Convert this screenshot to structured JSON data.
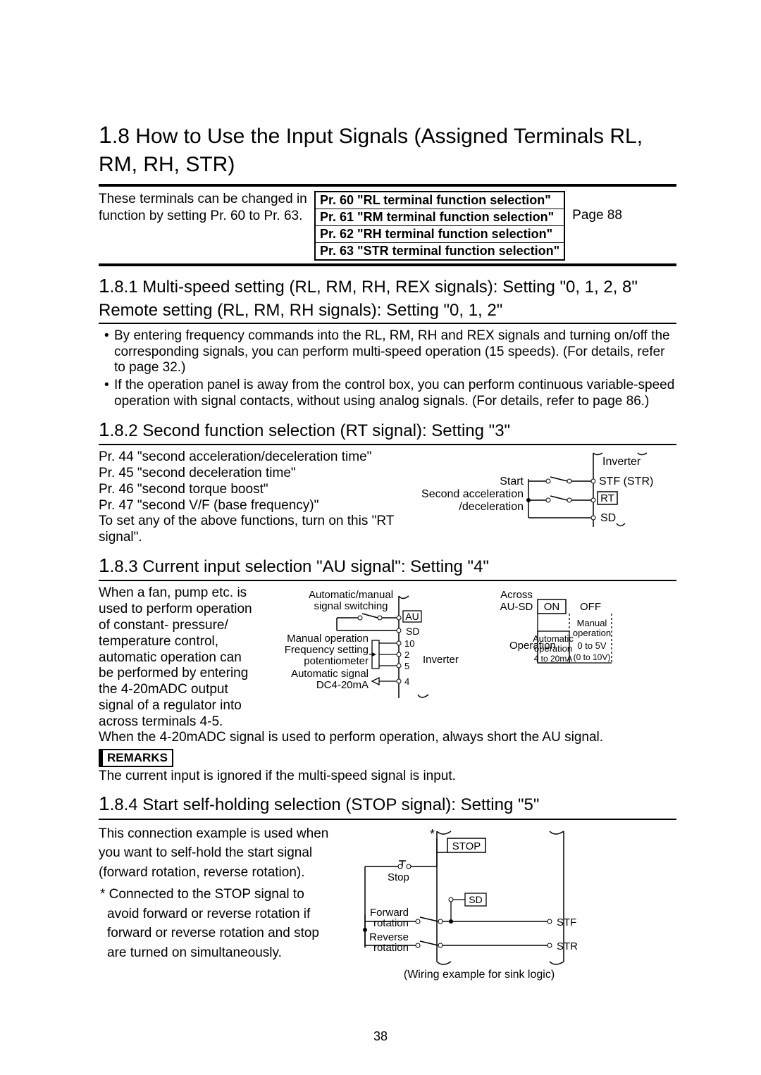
{
  "page_number": "38",
  "title_prefix": "1",
  "title_rest": ".8 How to Use the Input Signals (Assigned Terminals RL, RM, RH, STR)",
  "intro_text": "These terminals can be changed in function by setting Pr. 60 to Pr. 63.",
  "param_list": [
    "Pr. 60 \"RL terminal function selection\"",
    "Pr. 61 \"RM terminal function selection\"",
    "Pr. 62 \"RH terminal function selection\"",
    "Pr. 63 \"STR terminal function selection\""
  ],
  "page_ref": "Page 88",
  "s181": {
    "num": "1",
    "rest": ".8.1 Multi-speed setting (RL, RM, RH, REX signals): Setting \"0, 1, 2, 8\" Remote setting (RL, RM, RH signals): Setting \"0, 1, 2\"",
    "bullets": [
      "By entering frequency commands into the RL, RM, RH and REX signals and turning on/off the corresponding signals, you can perform multi-speed operation (15 speeds). (For details, refer to page 32.)",
      "If the operation panel is away from the control box, you can perform continuous variable-speed operation with signal contacts, without using analog signals. (For details, refer to page 86.)"
    ]
  },
  "s182": {
    "num": "1",
    "rest": ".8.2 Second function selection (RT signal): Setting \"3\"",
    "lines": [
      "Pr. 44 \"second acceleration/deceleration time\"",
      "Pr. 45 \"second deceleration time\"",
      "Pr. 46 \"second torque boost\"",
      "Pr. 47 \"second V/F (base frequency)\"",
      "To set any of the above functions, turn on this \"RT signal\"."
    ],
    "diagram": {
      "inverter": "Inverter",
      "start": "Start",
      "sec_accel1": "Second acceleration",
      "sec_accel2": "/deceleration",
      "stf": "STF (STR)",
      "rt": "RT",
      "sd": "SD"
    }
  },
  "s183": {
    "num": "1",
    "rest": ".8.3 Current input selection \"AU signal\": Setting \"4\"",
    "left_text": "When a fan, pump etc. is used to perform operation of constant- pressure/ temperature control, automatic operation can be performed by entering the 4-20mADC output signal of a regulator into across terminals 4-5.",
    "after_text": "When the 4-20mADC signal is used to perform operation, always short the AU signal.",
    "diagram_left": {
      "l1": "Automatic/manual",
      "l2": "signal switching",
      "l3": "Manual operation",
      "l4": "Frequency setting",
      "l5": "potentiometer",
      "l6": "Automatic signal",
      "l7": "DC4-20mA",
      "au": "AU",
      "sd": "SD",
      "t10": "10",
      "t2": "2",
      "t5": "5",
      "t4": "4",
      "inverter": "Inverter"
    },
    "diagram_right": {
      "across": "Across",
      "ausd": "AU-SD",
      "on": "ON",
      "off": "OFF",
      "operation": "Operation",
      "auto_op1": "Automatic",
      "auto_op2": "operation",
      "auto_op3": "4 to 20mA",
      "man_op1": "Manual",
      "man_op2": "operation",
      "man_op3": "0 to 5V",
      "man_op4": "(0 to 10V)"
    },
    "remarks_label": "REMARKS",
    "remarks_text": "The current input is ignored if the multi-speed signal is input."
  },
  "s184": {
    "num": "1",
    "rest": ".8.4 Start self-holding selection (STOP signal): Setting \"5\"",
    "p1": "This connection example is used when you want to self-hold the start signal (forward rotation, reverse rotation).",
    "p2": "* Connected to the STOP signal to avoid forward or reverse rotation if forward or reverse rotation and stop are turned on simultaneously.",
    "diagram": {
      "stop_box": "STOP",
      "stop_lbl": "Stop",
      "sd": "SD",
      "fwd": "Forward",
      "fwd2": "rotation",
      "rev": "Reverse",
      "rev2": "rotation",
      "stf": "STF",
      "str": "STR",
      "star": "*",
      "caption": "(Wiring example for sink logic)"
    }
  }
}
